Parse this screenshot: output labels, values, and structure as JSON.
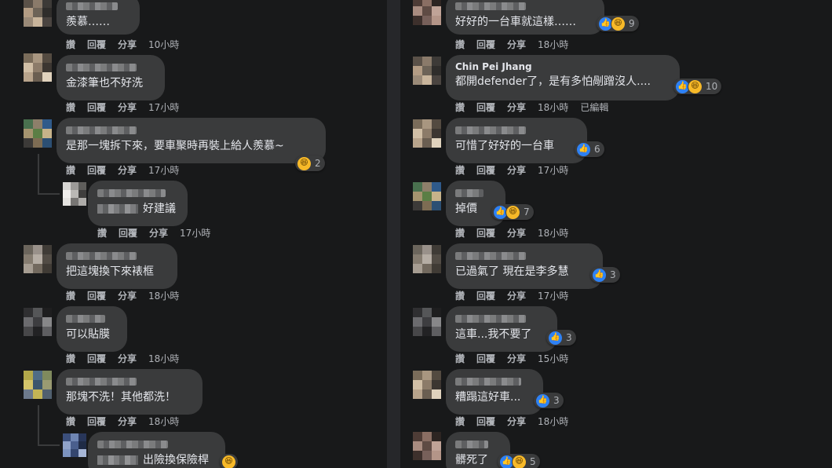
{
  "actions_labels": {
    "like": "讚",
    "reply": "回覆",
    "share": "分享",
    "edited": "已編輯"
  },
  "left": [
    {
      "id": "l1",
      "name": "",
      "text": "羨慕……",
      "time": "10小時"
    },
    {
      "id": "l2",
      "name": "",
      "text": "金漆筆也不好洗",
      "time": "17小時"
    },
    {
      "id": "l3",
      "name": "",
      "text": "是那一塊拆下來，要車聚時再裝上給人羨慕~",
      "time": "17小時",
      "reactions": [
        "haha"
      ],
      "count": "2"
    },
    {
      "id": "l4",
      "name": "",
      "text": "好建議",
      "time": "17小時"
    },
    {
      "id": "l5",
      "name": "",
      "text": "把這塊換下來裱框",
      "time": "18小時"
    },
    {
      "id": "l6",
      "name": "",
      "text": "可以貼膜",
      "time": "18小時"
    },
    {
      "id": "l7",
      "name": "",
      "text": "那塊不洗！其他都洗！",
      "time": "18小時"
    },
    {
      "id": "l8",
      "name": "",
      "text": "出險換保險桿",
      "time": "",
      "reactions": [
        "haha"
      ]
    }
  ],
  "right": [
    {
      "id": "r1",
      "name": "",
      "text": "好好的一台車就這樣……",
      "time": "18小時",
      "reactions": [
        "like",
        "haha"
      ],
      "count": "9"
    },
    {
      "id": "r2",
      "name": "Chin Pei Jhang",
      "text": "都開defender了，是有多怕剮蹭沒人....",
      "time": "18小時",
      "edited": true,
      "reactions": [
        "like",
        "haha"
      ],
      "count": "10"
    },
    {
      "id": "r3",
      "name": "",
      "text": "可惜了好好的一台車",
      "time": "17小時",
      "reactions": [
        "like"
      ],
      "count": "6"
    },
    {
      "id": "r4",
      "name": "",
      "text": "掉價",
      "time": "18小時",
      "reactions": [
        "like",
        "haha"
      ],
      "count": "7"
    },
    {
      "id": "r5",
      "name": "",
      "text": "已過氣了 現在是李多慧",
      "time": "17小時",
      "reactions": [
        "like"
      ],
      "count": "3"
    },
    {
      "id": "r6",
      "name": "",
      "text": "這車...我不要了",
      "time": "15小時",
      "reactions": [
        "like"
      ],
      "count": "3"
    },
    {
      "id": "r7",
      "name": "",
      "text": "糟蹋這好車...",
      "time": "18小時",
      "reactions": [
        "like"
      ],
      "count": "3"
    },
    {
      "id": "r8",
      "name": "",
      "text": "髒死了",
      "time": "",
      "reactions": [
        "like",
        "haha"
      ],
      "count": "5"
    }
  ],
  "colors": {
    "background": "#18191a",
    "bubble": "#3a3b3c",
    "text": "#e4e6eb",
    "meta": "#b0b3b8",
    "like": "#2e81f4",
    "haha": "#f7b928"
  },
  "icons": {
    "like": "like-icon",
    "haha": "haha-icon"
  }
}
